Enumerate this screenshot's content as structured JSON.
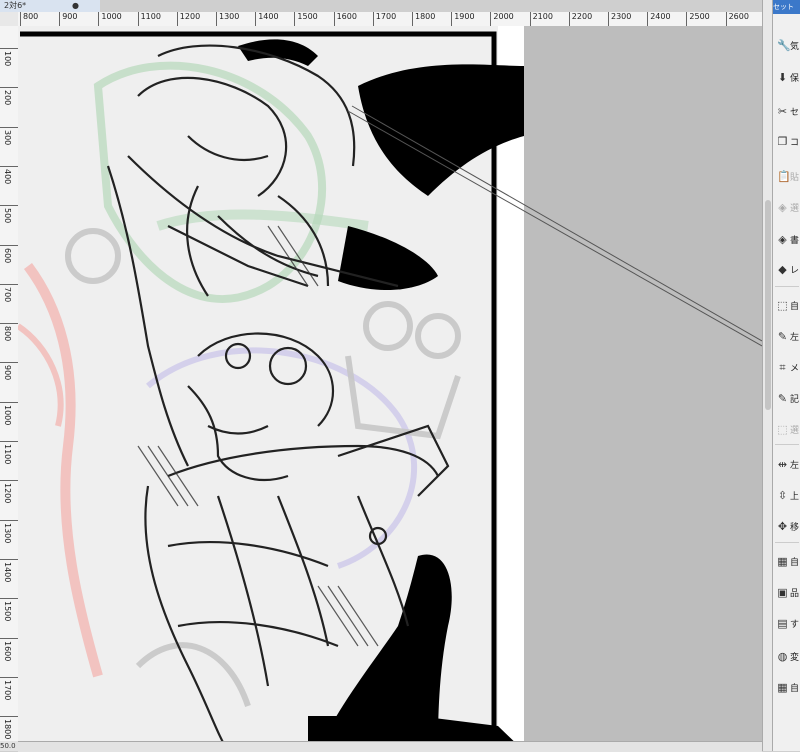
{
  "tab": {
    "title": "2対6*",
    "close": "●"
  },
  "ruler": {
    "horizontal": [
      "800",
      "900",
      "1000",
      "1100",
      "1200",
      "1300",
      "1400",
      "1500",
      "1600",
      "1700",
      "1800",
      "1900",
      "2000",
      "2100",
      "2200",
      "2300",
      "2400",
      "2500",
      "2600"
    ],
    "vertical": [
      "100",
      "200",
      "300",
      "400",
      "500",
      "600",
      "700",
      "800",
      "900",
      "1000",
      "1100",
      "1200",
      "1300",
      "1400",
      "1500",
      "1600",
      "1700",
      "1800"
    ]
  },
  "panel": {
    "header": "セット",
    "items": [
      {
        "icon": "wrench-icon",
        "glyph": "🔧",
        "label": "気"
      },
      {
        "icon": "save-icon",
        "glyph": "⬇",
        "label": "保"
      },
      {
        "icon": "cut-icon",
        "glyph": "✂",
        "label": "セ"
      },
      {
        "icon": "copy-icon",
        "glyph": "❐",
        "label": "コ"
      },
      {
        "icon": "paste-icon",
        "glyph": "📋",
        "label": "貼",
        "disabled": true
      },
      {
        "icon": "layer-icon",
        "glyph": "◈",
        "label": "選",
        "disabled": true
      },
      {
        "icon": "layers-icon",
        "glyph": "◈",
        "label": "書"
      },
      {
        "icon": "layer-property-icon",
        "glyph": "◆",
        "label": "レ"
      },
      {
        "icon": "transform-icon",
        "glyph": "⬚",
        "label": "自"
      },
      {
        "icon": "pen-icon",
        "glyph": "✎",
        "label": "左"
      },
      {
        "icon": "mesh-icon",
        "glyph": "⌗",
        "label": "メ"
      },
      {
        "icon": "brush-icon",
        "glyph": "✎",
        "label": "記"
      },
      {
        "icon": "selection-icon",
        "glyph": "⬚",
        "label": "選",
        "disabled": true
      },
      {
        "icon": "flip-horizontal-icon",
        "glyph": "⇹",
        "label": "左"
      },
      {
        "icon": "flip-vertical-icon",
        "glyph": "⇳",
        "label": "上"
      },
      {
        "icon": "move-icon",
        "glyph": "✥",
        "label": "移"
      },
      {
        "icon": "grid-icon",
        "glyph": "▦",
        "label": "自"
      },
      {
        "icon": "frame-icon",
        "glyph": "▣",
        "label": "品"
      },
      {
        "icon": "ruler-icon",
        "glyph": "▤",
        "label": "す"
      },
      {
        "icon": "tone-icon",
        "glyph": "◍",
        "label": "変"
      },
      {
        "icon": "panel-icon",
        "glyph": "▦",
        "label": "自"
      }
    ]
  },
  "status": {
    "zoom": "50.0"
  }
}
